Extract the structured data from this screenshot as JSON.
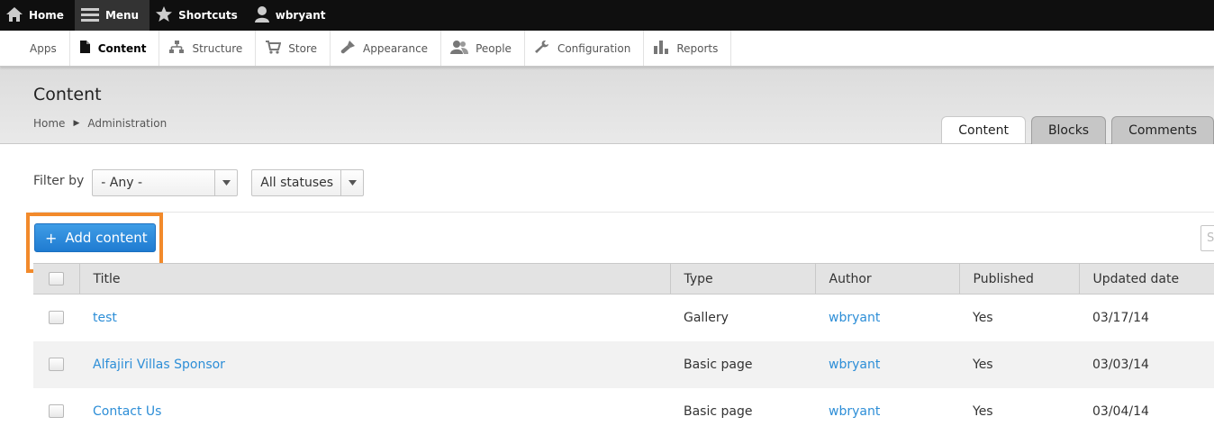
{
  "toolbar": {
    "home": "Home",
    "menu": "Menu",
    "shortcuts": "Shortcuts",
    "user": "wbryant"
  },
  "tray": {
    "items": [
      "Apps",
      "Content",
      "Structure",
      "Store",
      "Appearance",
      "People",
      "Configuration",
      "Reports"
    ],
    "active": "Content"
  },
  "header": {
    "title": "Content",
    "breadcrumb": [
      "Home",
      "Administration"
    ],
    "tabs": [
      "Content",
      "Blocks",
      "Comments"
    ],
    "active_tab": "Content"
  },
  "filter": {
    "label": "Filter by",
    "type_value": "- Any -",
    "status_value": "All statuses"
  },
  "actions": {
    "add_content": "Add content",
    "search_placeholder": "S"
  },
  "table": {
    "columns": [
      "Title",
      "Type",
      "Author",
      "Published",
      "Updated date"
    ],
    "rows": [
      {
        "title": "test",
        "type": "Gallery",
        "author": "wbryant",
        "published": "Yes",
        "updated": "03/17/14"
      },
      {
        "title": "Alfajiri Villas Sponsor",
        "type": "Basic page",
        "author": "wbryant",
        "published": "Yes",
        "updated": "03/03/14"
      },
      {
        "title": "Contact Us",
        "type": "Basic page",
        "author": "wbryant",
        "published": "Yes",
        "updated": "03/04/14"
      }
    ]
  },
  "colors": {
    "accent": "#2d8ed7",
    "button": "#2a86d8",
    "highlight": "#f28a2b"
  }
}
